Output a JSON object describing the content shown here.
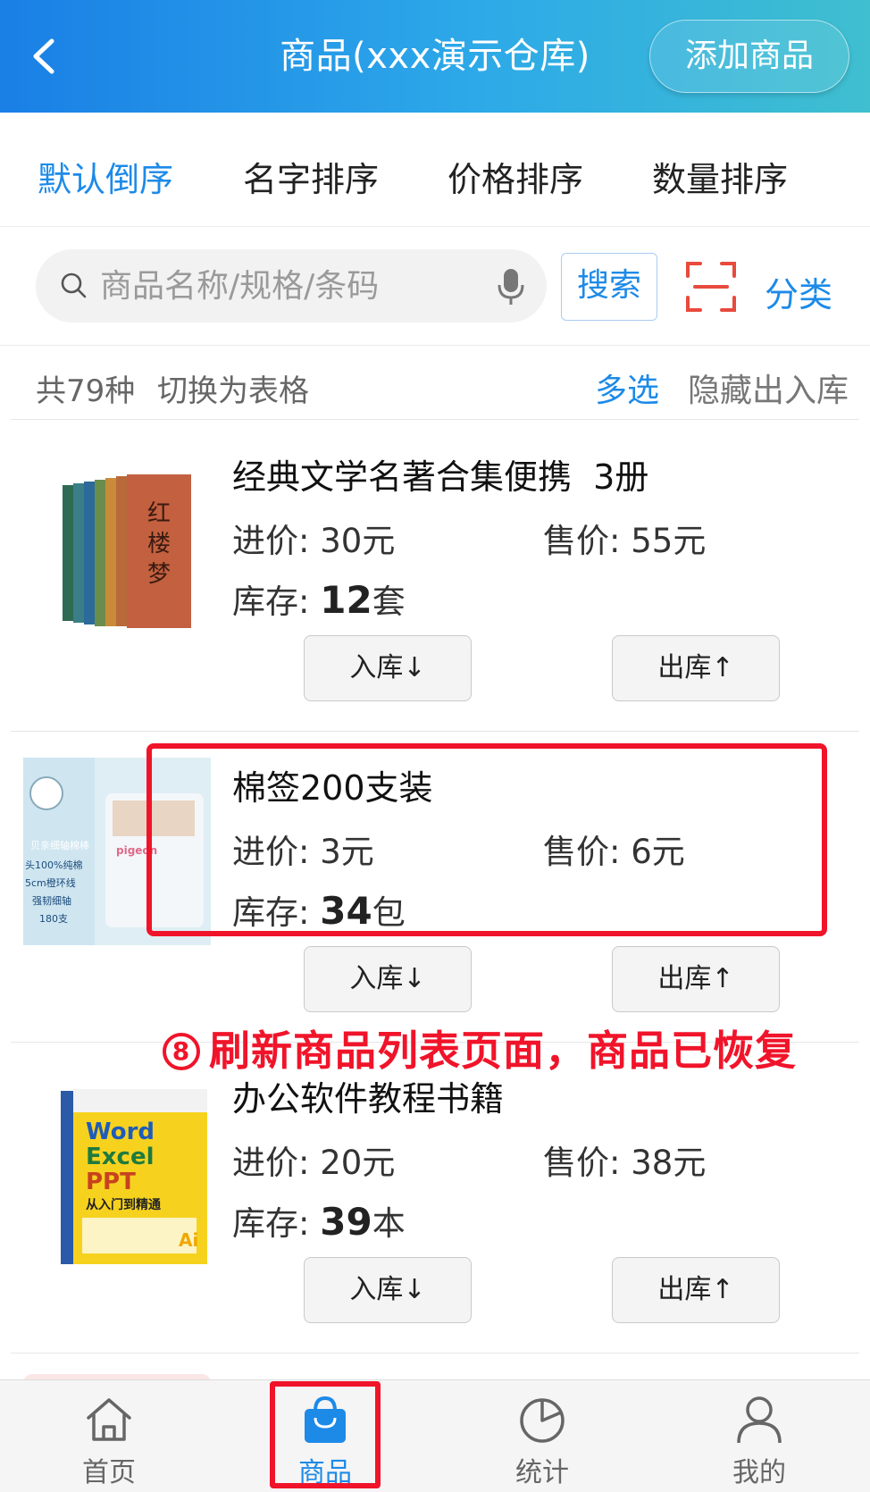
{
  "header": {
    "title": "商品(xxx演示仓库)",
    "add_button": "添加商品"
  },
  "sort_tabs": [
    "默认倒序",
    "名字排序",
    "价格排序",
    "数量排序"
  ],
  "search": {
    "placeholder": "商品名称/规格/条码",
    "button": "搜索",
    "category": "分类"
  },
  "info": {
    "count": "共79种",
    "switch_table": "切换为表格",
    "multi_select": "多选",
    "hide_io": "隐藏出入库"
  },
  "products": [
    {
      "name": "经典文学名著合集便携  3册",
      "cost_label": "进价:",
      "cost": "30元",
      "price_label": "售价:",
      "price": "55元",
      "stock_label": "库存:",
      "stock_num": "12",
      "stock_unit": "套",
      "in": "入库↓",
      "out": "出库↑"
    },
    {
      "name": "棉签200支装",
      "cost_label": "进价:",
      "cost": "3元",
      "price_label": "售价:",
      "price": "6元",
      "stock_label": "库存:",
      "stock_num": "34",
      "stock_unit": "包",
      "in": "入库↓",
      "out": "出库↑"
    },
    {
      "name": "办公软件教程书籍",
      "cost_label": "进价:",
      "cost": "20元",
      "price_label": "售价:",
      "price": "38元",
      "stock_label": "库存:",
      "stock_num": "39",
      "stock_unit": "本",
      "in": "入库↓",
      "out": "出库↑"
    }
  ],
  "thumb_text": {
    "book_title": "红楼梦",
    "swab_lines": [
      "贝亲细轴棉棒",
      "头100%纯棉",
      "5cm橙环线",
      "强韧细轴",
      "180支"
    ],
    "swab_brand": "pigeon",
    "office_words": [
      "Word",
      "Excel",
      "PPT",
      "从入门到精通",
      "Ai"
    ]
  },
  "annotation": {
    "number": "8",
    "text": "刷新商品列表页面，商品已恢复"
  },
  "nav": [
    {
      "label": "首页",
      "icon": "home-icon"
    },
    {
      "label": "商品",
      "icon": "bag-icon"
    },
    {
      "label": "统计",
      "icon": "pie-chart-icon"
    },
    {
      "label": "我的",
      "icon": "user-icon"
    }
  ],
  "colors": {
    "accent": "#1d8ae8",
    "annotation": "#f0142a",
    "header_start": "#1a7fe6",
    "header_end": "#3fbfcf"
  }
}
